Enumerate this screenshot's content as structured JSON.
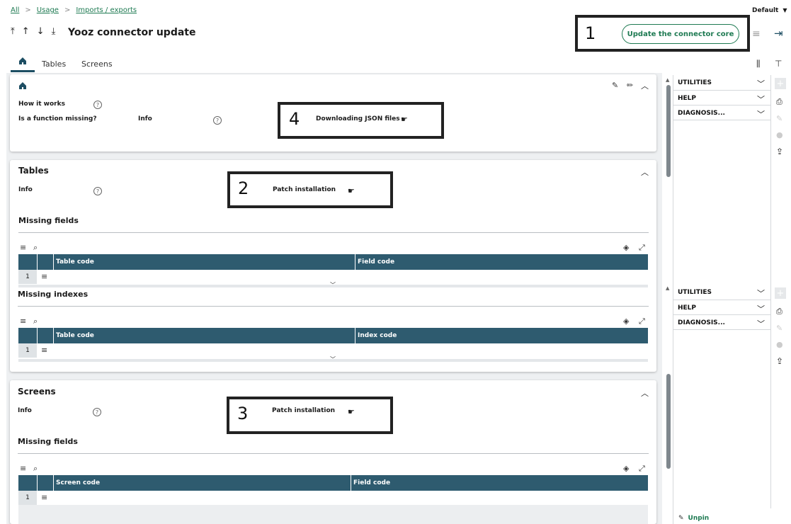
{
  "breadcrumbs": [
    "All",
    "Usage",
    "Imports / exports"
  ],
  "header": {
    "title": "Yooz connector update",
    "default_label": "Default",
    "update_button": "Update the connector core"
  },
  "tabs": [
    "Tables",
    "Screens"
  ],
  "callouts": {
    "c1": "1",
    "c2": "2",
    "c3": "3",
    "c4": "4"
  },
  "home_panel": {
    "how_it_works": "How it works",
    "function_missing": "Is a function missing?",
    "info": "Info",
    "downloading_json": "Downloading JSON files"
  },
  "tables_section": {
    "title": "Tables",
    "info": "Info",
    "patch_installation": "Patch installation",
    "missing_fields": "Missing fields",
    "missing_fields_cols": [
      "Table code",
      "Field code"
    ],
    "missing_indexes": "Missing indexes",
    "missing_indexes_cols": [
      "Table code",
      "Index code"
    ],
    "row_num": "1"
  },
  "screens_section": {
    "title": "Screens",
    "info": "Info",
    "patch_installation": "Patch installation",
    "missing_fields": "Missing fields",
    "missing_fields_cols": [
      "Screen code",
      "Field code"
    ],
    "row_num": "1"
  },
  "right_panel_top": [
    "UTILITIES",
    "HELP",
    "DIAGNOSIS..."
  ],
  "right_panel_bottom": [
    "UTILITIES",
    "HELP",
    "DIAGNOSIS..."
  ],
  "unpin_label": "Unpin",
  "colors": {
    "accent": "#1e7a52",
    "grid_header": "#2e5b6f"
  },
  "icons": [
    "home-icon",
    "help-icon",
    "pin-icon",
    "edit-icon",
    "chevron-up-icon",
    "hamburger-icon",
    "search-icon",
    "layers-icon",
    "expand-icon",
    "print-icon",
    "attachment-icon",
    "comment-icon",
    "share-icon",
    "logout-icon",
    "plus-icon",
    "run-icon"
  ]
}
